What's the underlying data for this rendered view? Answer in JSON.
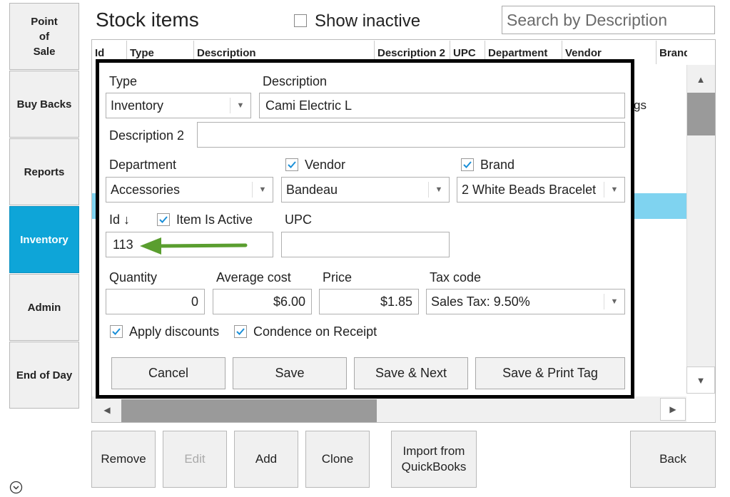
{
  "nav": {
    "items": [
      {
        "label": "Point\nof\nSale",
        "active": false
      },
      {
        "label": "Buy Backs",
        "active": false
      },
      {
        "label": "Reports",
        "active": false
      },
      {
        "label": "Inventory",
        "active": true
      },
      {
        "label": "Admin",
        "active": false
      },
      {
        "label": "End of Day",
        "active": false
      }
    ],
    "expand_icon": "chevron-down-circle-icon"
  },
  "header": {
    "title": "Stock items",
    "show_inactive_label": "Show inactive",
    "show_inactive_checked": false,
    "search_placeholder": "Search by Description"
  },
  "table": {
    "columns": [
      "Id",
      "Type",
      "Description",
      "Description 2",
      "UPC",
      "Department",
      "Vendor",
      "Brand"
    ],
    "visible_row_fragment": "gs"
  },
  "dialog": {
    "type_label": "Type",
    "type_value": "Inventory",
    "description_label": "Description",
    "description_value": "Cami Electric L",
    "description2_label": "Description 2",
    "description2_value": "",
    "department_label": "Department",
    "department_value": "Accessories",
    "vendor_label": "Vendor",
    "vendor_checked": true,
    "vendor_value": "Bandeau",
    "brand_label": "Brand",
    "brand_checked": true,
    "brand_value": "2 White Beads Bracelet",
    "id_label": "Id ↓",
    "id_value": "113",
    "item_active_label": "Item Is Active",
    "item_active_checked": true,
    "upc_label": "UPC",
    "upc_value": "",
    "quantity_label": "Quantity",
    "quantity_value": "0",
    "avg_cost_label": "Average cost",
    "avg_cost_value": "$6.00",
    "price_label": "Price",
    "price_value": "$1.85",
    "tax_label": "Tax code",
    "tax_value": "Sales Tax: 9.50%",
    "apply_discounts_label": "Apply discounts",
    "apply_discounts_checked": true,
    "condence_label": "Condence on Receipt",
    "condence_checked": true,
    "buttons": {
      "cancel": "Cancel",
      "save": "Save",
      "save_next": "Save & Next",
      "save_print": "Save & Print Tag"
    }
  },
  "bottom_buttons": {
    "remove": "Remove",
    "edit": "Edit",
    "add": "Add",
    "clone": "Clone",
    "import": "Import from\nQuickBooks",
    "back": "Back"
  },
  "colors": {
    "accent": "#0ea5d8",
    "selected_row": "#7fd3f0",
    "arrow": "#5a9e2f"
  }
}
